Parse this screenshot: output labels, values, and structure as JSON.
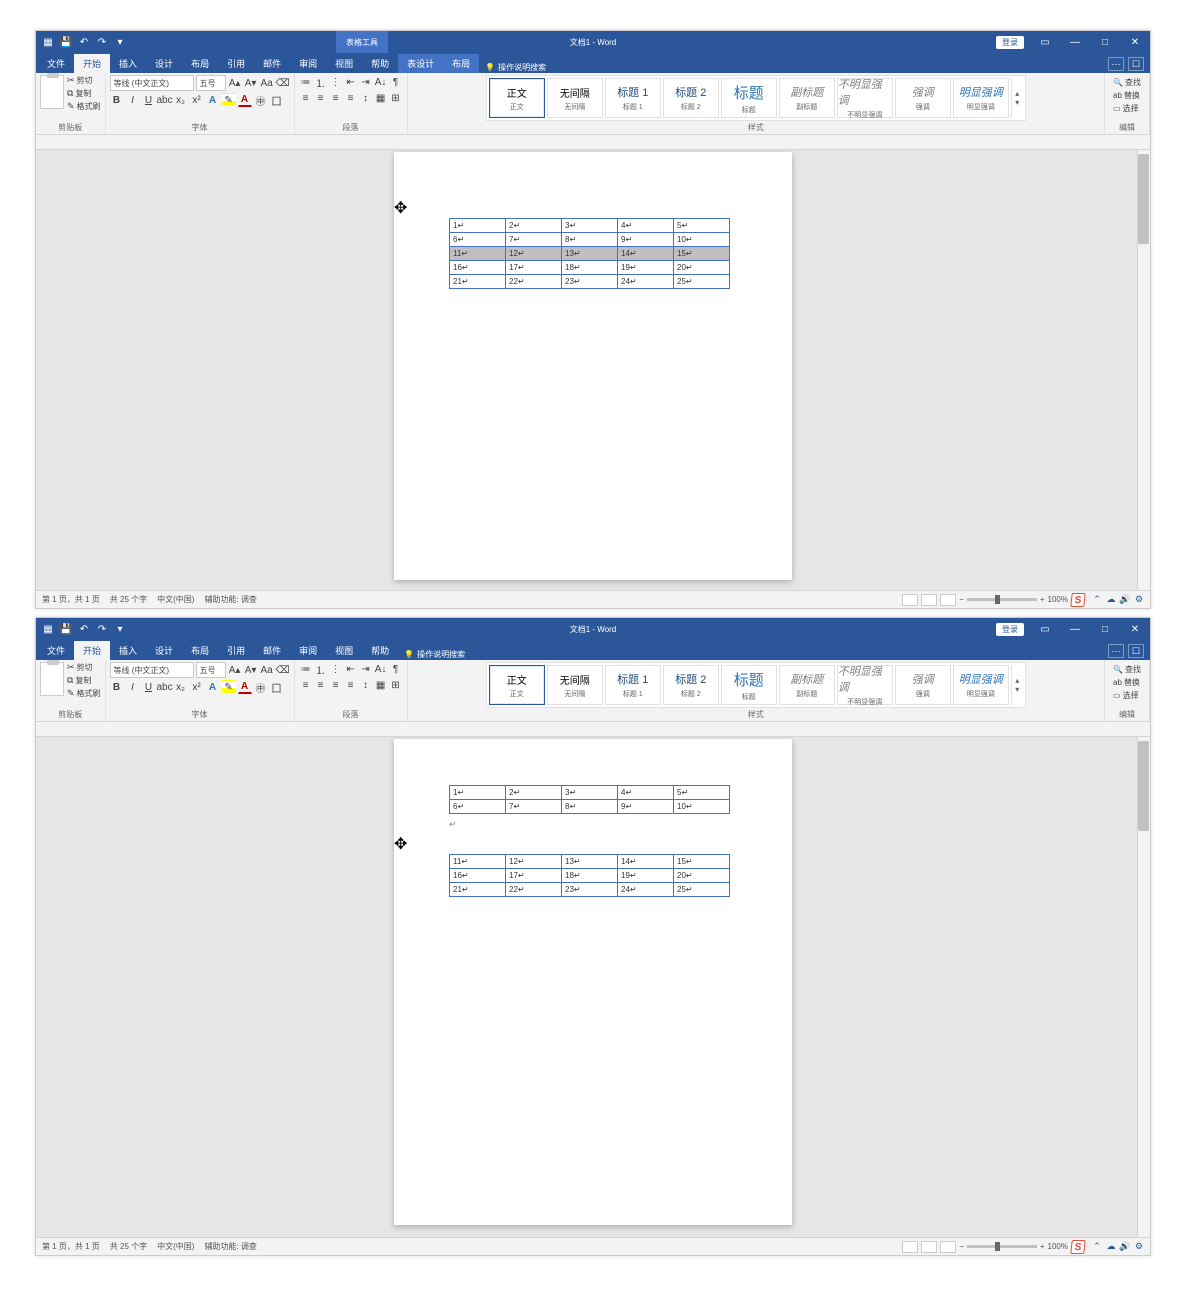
{
  "titlebar": {
    "context_tools": "表格工具",
    "doc_title": "文档1 - Word",
    "login": "登录"
  },
  "tabs": {
    "file": "文件",
    "home": "开始",
    "insert": "插入",
    "design": "设计",
    "layout": "布局",
    "references": "引用",
    "mailings": "邮件",
    "review": "审阅",
    "view": "视图",
    "help": "帮助",
    "table_design": "表设计",
    "table_layout": "布局",
    "tell_me": "操作说明搜索"
  },
  "ribbon": {
    "clipboard": {
      "cut": "剪切",
      "copy": "复制",
      "format_painter": "格式刷",
      "group": "剪贴板"
    },
    "font": {
      "name": "等线 (中文正文)",
      "size": "五号",
      "group": "字体"
    },
    "paragraph": {
      "group": "段落"
    },
    "styles": {
      "group": "样式",
      "items": [
        {
          "label": "正文",
          "preview": "正文"
        },
        {
          "label": "无间隔",
          "preview": "无间隔"
        },
        {
          "label": "标题 1",
          "preview": "标题 1"
        },
        {
          "label": "标题 2",
          "preview": "标题 2"
        },
        {
          "label": "标题",
          "preview": "标题"
        },
        {
          "label": "副标题",
          "preview": "副标题"
        },
        {
          "label": "不明显强调",
          "preview": "不明显强调"
        },
        {
          "label": "强调",
          "preview": "强调"
        },
        {
          "label": "明显强调",
          "preview": "明显强调"
        }
      ]
    },
    "editing": {
      "find": "查找",
      "replace": "替换",
      "select": "选择",
      "group": "编辑"
    }
  },
  "instance1": {
    "table": [
      [
        "1",
        "2",
        "3",
        "4",
        "5"
      ],
      [
        "6",
        "7",
        "8",
        "9",
        "10"
      ],
      [
        "11",
        "12",
        "13",
        "14",
        "15"
      ],
      [
        "16",
        "17",
        "18",
        "19",
        "20"
      ],
      [
        "21",
        "22",
        "23",
        "24",
        "25"
      ]
    ],
    "selected_row": 2,
    "status": {
      "page": "第 1 页，共 1 页",
      "words": "共 25 个字",
      "lang": "中文(中国)",
      "accessibility": "辅助功能: 调查",
      "zoom": "100%"
    }
  },
  "instance2": {
    "table_a": [
      [
        "1",
        "2",
        "3",
        "4",
        "5"
      ],
      [
        "6",
        "7",
        "8",
        "9",
        "10"
      ]
    ],
    "table_b": [
      [
        "11",
        "12",
        "13",
        "14",
        "15"
      ],
      [
        "16",
        "17",
        "18",
        "19",
        "20"
      ],
      [
        "21",
        "22",
        "23",
        "24",
        "25"
      ]
    ],
    "status": {
      "page": "第 1 页，共 1 页",
      "words": "共 25 个字",
      "lang": "中文(中国)",
      "accessibility": "辅助功能: 调查",
      "zoom": "100%"
    }
  }
}
